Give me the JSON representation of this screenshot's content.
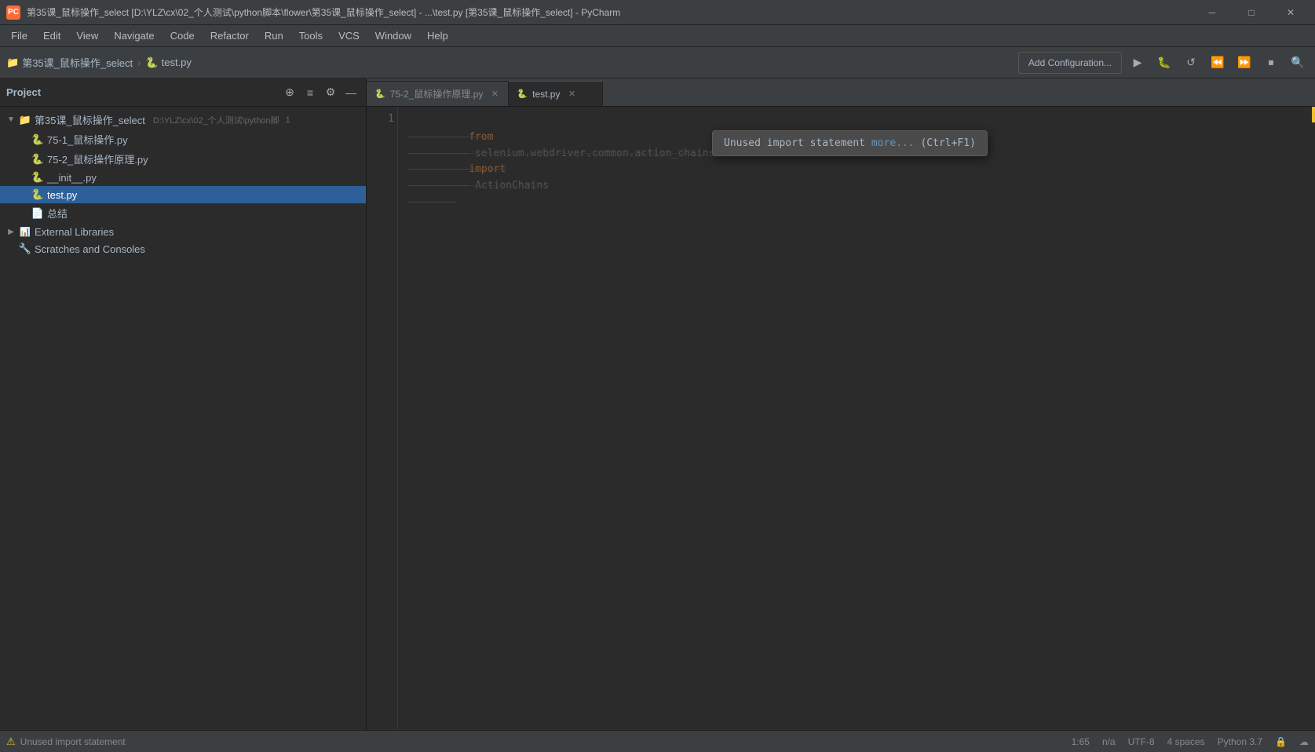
{
  "titleBar": {
    "icon": "PC",
    "title": "第35课_鼠标操作_select [D:\\YLZ\\cx\\02_个人测试\\python脚本\\flower\\第35课_鼠标操作_select] - ...\\test.py [第35课_鼠标操作_select] - PyCharm",
    "minimize": "─",
    "maximize": "□",
    "close": "✕"
  },
  "menuBar": {
    "items": [
      "File",
      "Edit",
      "View",
      "Navigate",
      "Code",
      "Refactor",
      "Run",
      "Tools",
      "VCS",
      "Window",
      "Help"
    ]
  },
  "toolbar": {
    "breadcrumb": [
      {
        "icon": "📁",
        "label": "第35课_鼠标操作_select"
      },
      {
        "icon": "🐍",
        "label": "test.py"
      }
    ],
    "addConfig": "Add Configuration...",
    "buttons": [
      "▶",
      "🐛",
      "↺",
      "⏪",
      "⏩",
      "⏹",
      "🔍"
    ]
  },
  "sidebar": {
    "title": "Project",
    "actions": [
      "⊕",
      "≡",
      "⚙",
      "—"
    ],
    "tree": [
      {
        "level": 0,
        "expanded": true,
        "arrow": "▼",
        "icon": "folder",
        "label": "第35课_鼠标操作_select",
        "suffix": "D:\\YLZ\\cx\\02_个人测试\\python脚",
        "lineNum": "1"
      },
      {
        "level": 1,
        "expanded": false,
        "arrow": "",
        "icon": "python",
        "label": "75-1_鼠标操作.py"
      },
      {
        "level": 1,
        "expanded": false,
        "arrow": "",
        "icon": "python",
        "label": "75-2_鼠标操作原理.py"
      },
      {
        "level": 1,
        "expanded": false,
        "arrow": "",
        "icon": "python",
        "label": "__init__.py"
      },
      {
        "level": 1,
        "expanded": false,
        "arrow": "",
        "icon": "python",
        "label": "test.py",
        "selected": true
      },
      {
        "level": 1,
        "expanded": false,
        "arrow": "",
        "icon": "file",
        "label": "总结"
      },
      {
        "level": 0,
        "expanded": false,
        "arrow": "▶",
        "icon": "lib",
        "label": "External Libraries"
      },
      {
        "level": 0,
        "expanded": false,
        "arrow": "",
        "icon": "scratch",
        "label": "Scratches and Consoles"
      }
    ]
  },
  "editor": {
    "tabs": [
      {
        "icon": "🐍",
        "label": "75-2_鼠标操作原理.py",
        "active": false,
        "closeable": true
      },
      {
        "icon": "🐍",
        "label": "test.py",
        "active": true,
        "closeable": true
      }
    ],
    "lineNumbers": [
      "1"
    ],
    "codeLine": "from selenium.webdriver.common.action_chains import ActionChains",
    "tooltip": {
      "text": "Unused import statement",
      "link": "more...",
      "shortcut": "(Ctrl+F1)"
    }
  },
  "statusBar": {
    "warning": "Unused import statement",
    "position": "1:65",
    "selection": "n/a",
    "encoding": "UTF-8",
    "indent": "4 spaces",
    "python": "Python 3.7",
    "icons": [
      "🔒",
      "☁"
    ]
  }
}
